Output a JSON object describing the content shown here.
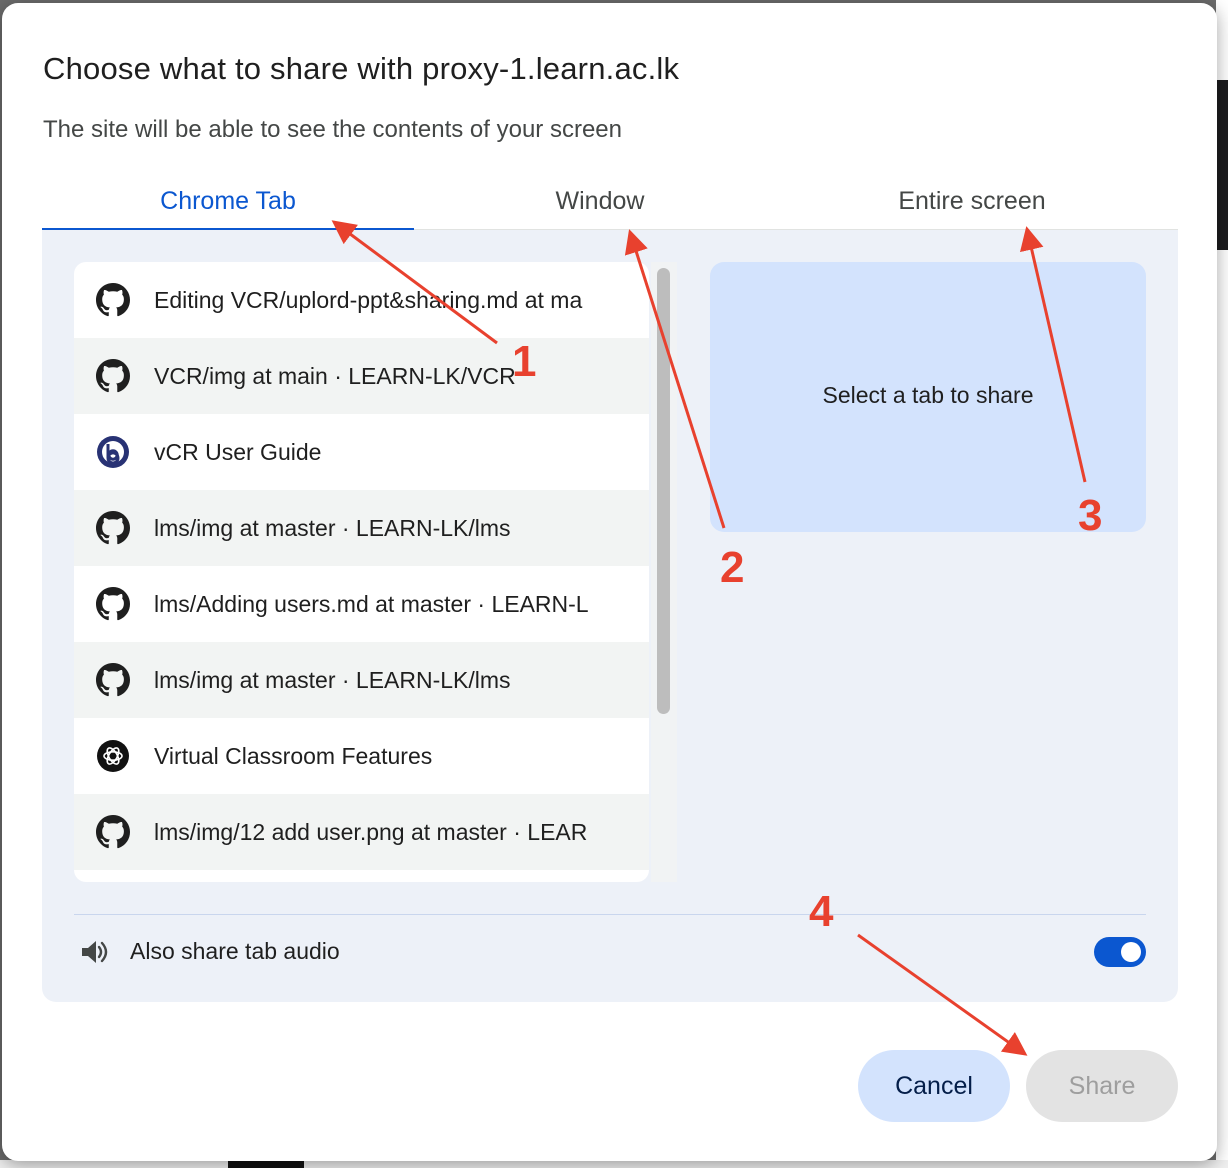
{
  "dialog": {
    "title": "Choose what to share with proxy-1.learn.ac.lk",
    "subtitle": "The site will be able to see the contents of your screen"
  },
  "tabs": [
    {
      "label": "Chrome Tab",
      "active": true
    },
    {
      "label": "Window",
      "active": false
    },
    {
      "label": "Entire screen",
      "active": false
    }
  ],
  "tab_list": [
    {
      "label": "Editing VCR/uplord-ppt&sharing.md at ma",
      "icon": "github-icon"
    },
    {
      "label": "VCR/img at main · LEARN-LK/VCR",
      "icon": "github-icon"
    },
    {
      "label": "vCR User Guide",
      "icon": "bigbluebutton-icon"
    },
    {
      "label": "lms/img at master · LEARN-LK/lms",
      "icon": "github-icon"
    },
    {
      "label": "lms/Adding users.md at master · LEARN-L",
      "icon": "github-icon"
    },
    {
      "label": "lms/img at master · LEARN-LK/lms",
      "icon": "github-icon"
    },
    {
      "label": "Virtual Classroom Features",
      "icon": "openai-icon"
    },
    {
      "label": "lms/img/12 add user.png at master · LEAR",
      "icon": "github-icon"
    }
  ],
  "preview": {
    "text": "Select a tab to share"
  },
  "audio": {
    "label": "Also share tab audio",
    "enabled": true
  },
  "buttons": {
    "cancel": "Cancel",
    "share": "Share"
  },
  "annotations": [
    "1",
    "2",
    "3",
    "4"
  ],
  "colors": {
    "accent": "#0b57d0",
    "annotation": "#e8412e",
    "panel": "#edf1f8",
    "preview": "#d3e3fd"
  }
}
